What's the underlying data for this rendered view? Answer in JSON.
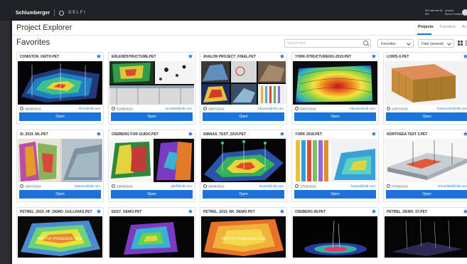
{
  "topbar": {
    "brand": "Schlumberger",
    "product": "DELFI",
    "user_lines": [
      "SIS Internal HQ",
      "KIS"
    ],
    "account_lines": [
      "account",
      "Demo Portfolios"
    ]
  },
  "header": {
    "title": "Project Explorer",
    "tabs": [
      {
        "label": "Projects",
        "active": true
      },
      {
        "label": "Transfers",
        "active": false
      },
      {
        "label": "Ac",
        "active": false
      }
    ]
  },
  "toolbar": {
    "section_title": "Favorites",
    "search_placeholder": "Search text",
    "filter_value": "Favorites",
    "sort_value": "Date (newest)"
  },
  "cards": [
    {
      "name": "CONISTON_KEITH.PET",
      "date": "06/08/2019",
      "user": "hfr44@slb.com",
      "open": "Open",
      "favorite": true
    },
    {
      "name": "ERLENDSTRUCTURE.PET",
      "date": "01/08/2019",
      "user": "acombat@slb.com",
      "open": "Open",
      "favorite": true
    },
    {
      "name": "AVALON PROJECT_FINAL.PET",
      "date": "30/07/2019",
      "user": "hfossa2@slb.com",
      "open": "Open",
      "favorite": true
    },
    {
      "name": "YORK-STRUCTURE001-2019.PET",
      "date": "30/07/2019",
      "user": "hfossa2@slb.com",
      "open": "Open",
      "favorite": true
    },
    {
      "name": "LORIS-X.PET",
      "date": "24/07/2019",
      "user": "fsolnouche@slb.com",
      "open": "Open",
      "favorite": true
    },
    {
      "name": "SI_2019_ML.PET",
      "date": "03/07/2019",
      "user": "rkasnen@slb.com",
      "open": "Open",
      "favorite": true
    },
    {
      "name": "OSEBERG FOR GUIDO.PET",
      "date": "29/05/2019",
      "user": "gfeiff@slb.com",
      "open": "Open",
      "favorite": true
    },
    {
      "name": "SIMAAS_TEST_2019.PET",
      "date": "28/05/2019",
      "user": "hsaeidi@slb.com",
      "open": "Open",
      "favorite": true
    },
    {
      "name": "YORK 2018.PET",
      "date": "27/05/2019",
      "user": "hsaeidi@slb.com",
      "open": "Open",
      "favorite": true
    },
    {
      "name": "NORTHSEA TEST 3.PET",
      "date": "07/05/2019",
      "user": "kmoorfield@slb.com",
      "open": "Open",
      "favorite": true
    },
    {
      "name": "PETREL_2019_HF_DEMO_GULLFAKS.PET",
      "date": "",
      "user": "",
      "open": "",
      "favorite": true
    },
    {
      "name": "EESY_DEMO.PET",
      "date": "",
      "user": "",
      "open": "",
      "favorite": true
    },
    {
      "name": "PETREL_2019_RK_DEMO.PET",
      "date": "",
      "user": "",
      "open": "",
      "favorite": true
    },
    {
      "name": "OSEBERG 08.PET",
      "date": "",
      "user": "",
      "open": "",
      "favorite": true
    },
    {
      "name": "PETREL_DEMO_07.PET",
      "date": "",
      "user": "",
      "open": "",
      "favorite": true
    }
  ],
  "thumb_text": {
    "not_for_production": "Not For Production Use"
  },
  "colors": {
    "accent": "#1a73d9",
    "topbar": "#1f2226"
  }
}
